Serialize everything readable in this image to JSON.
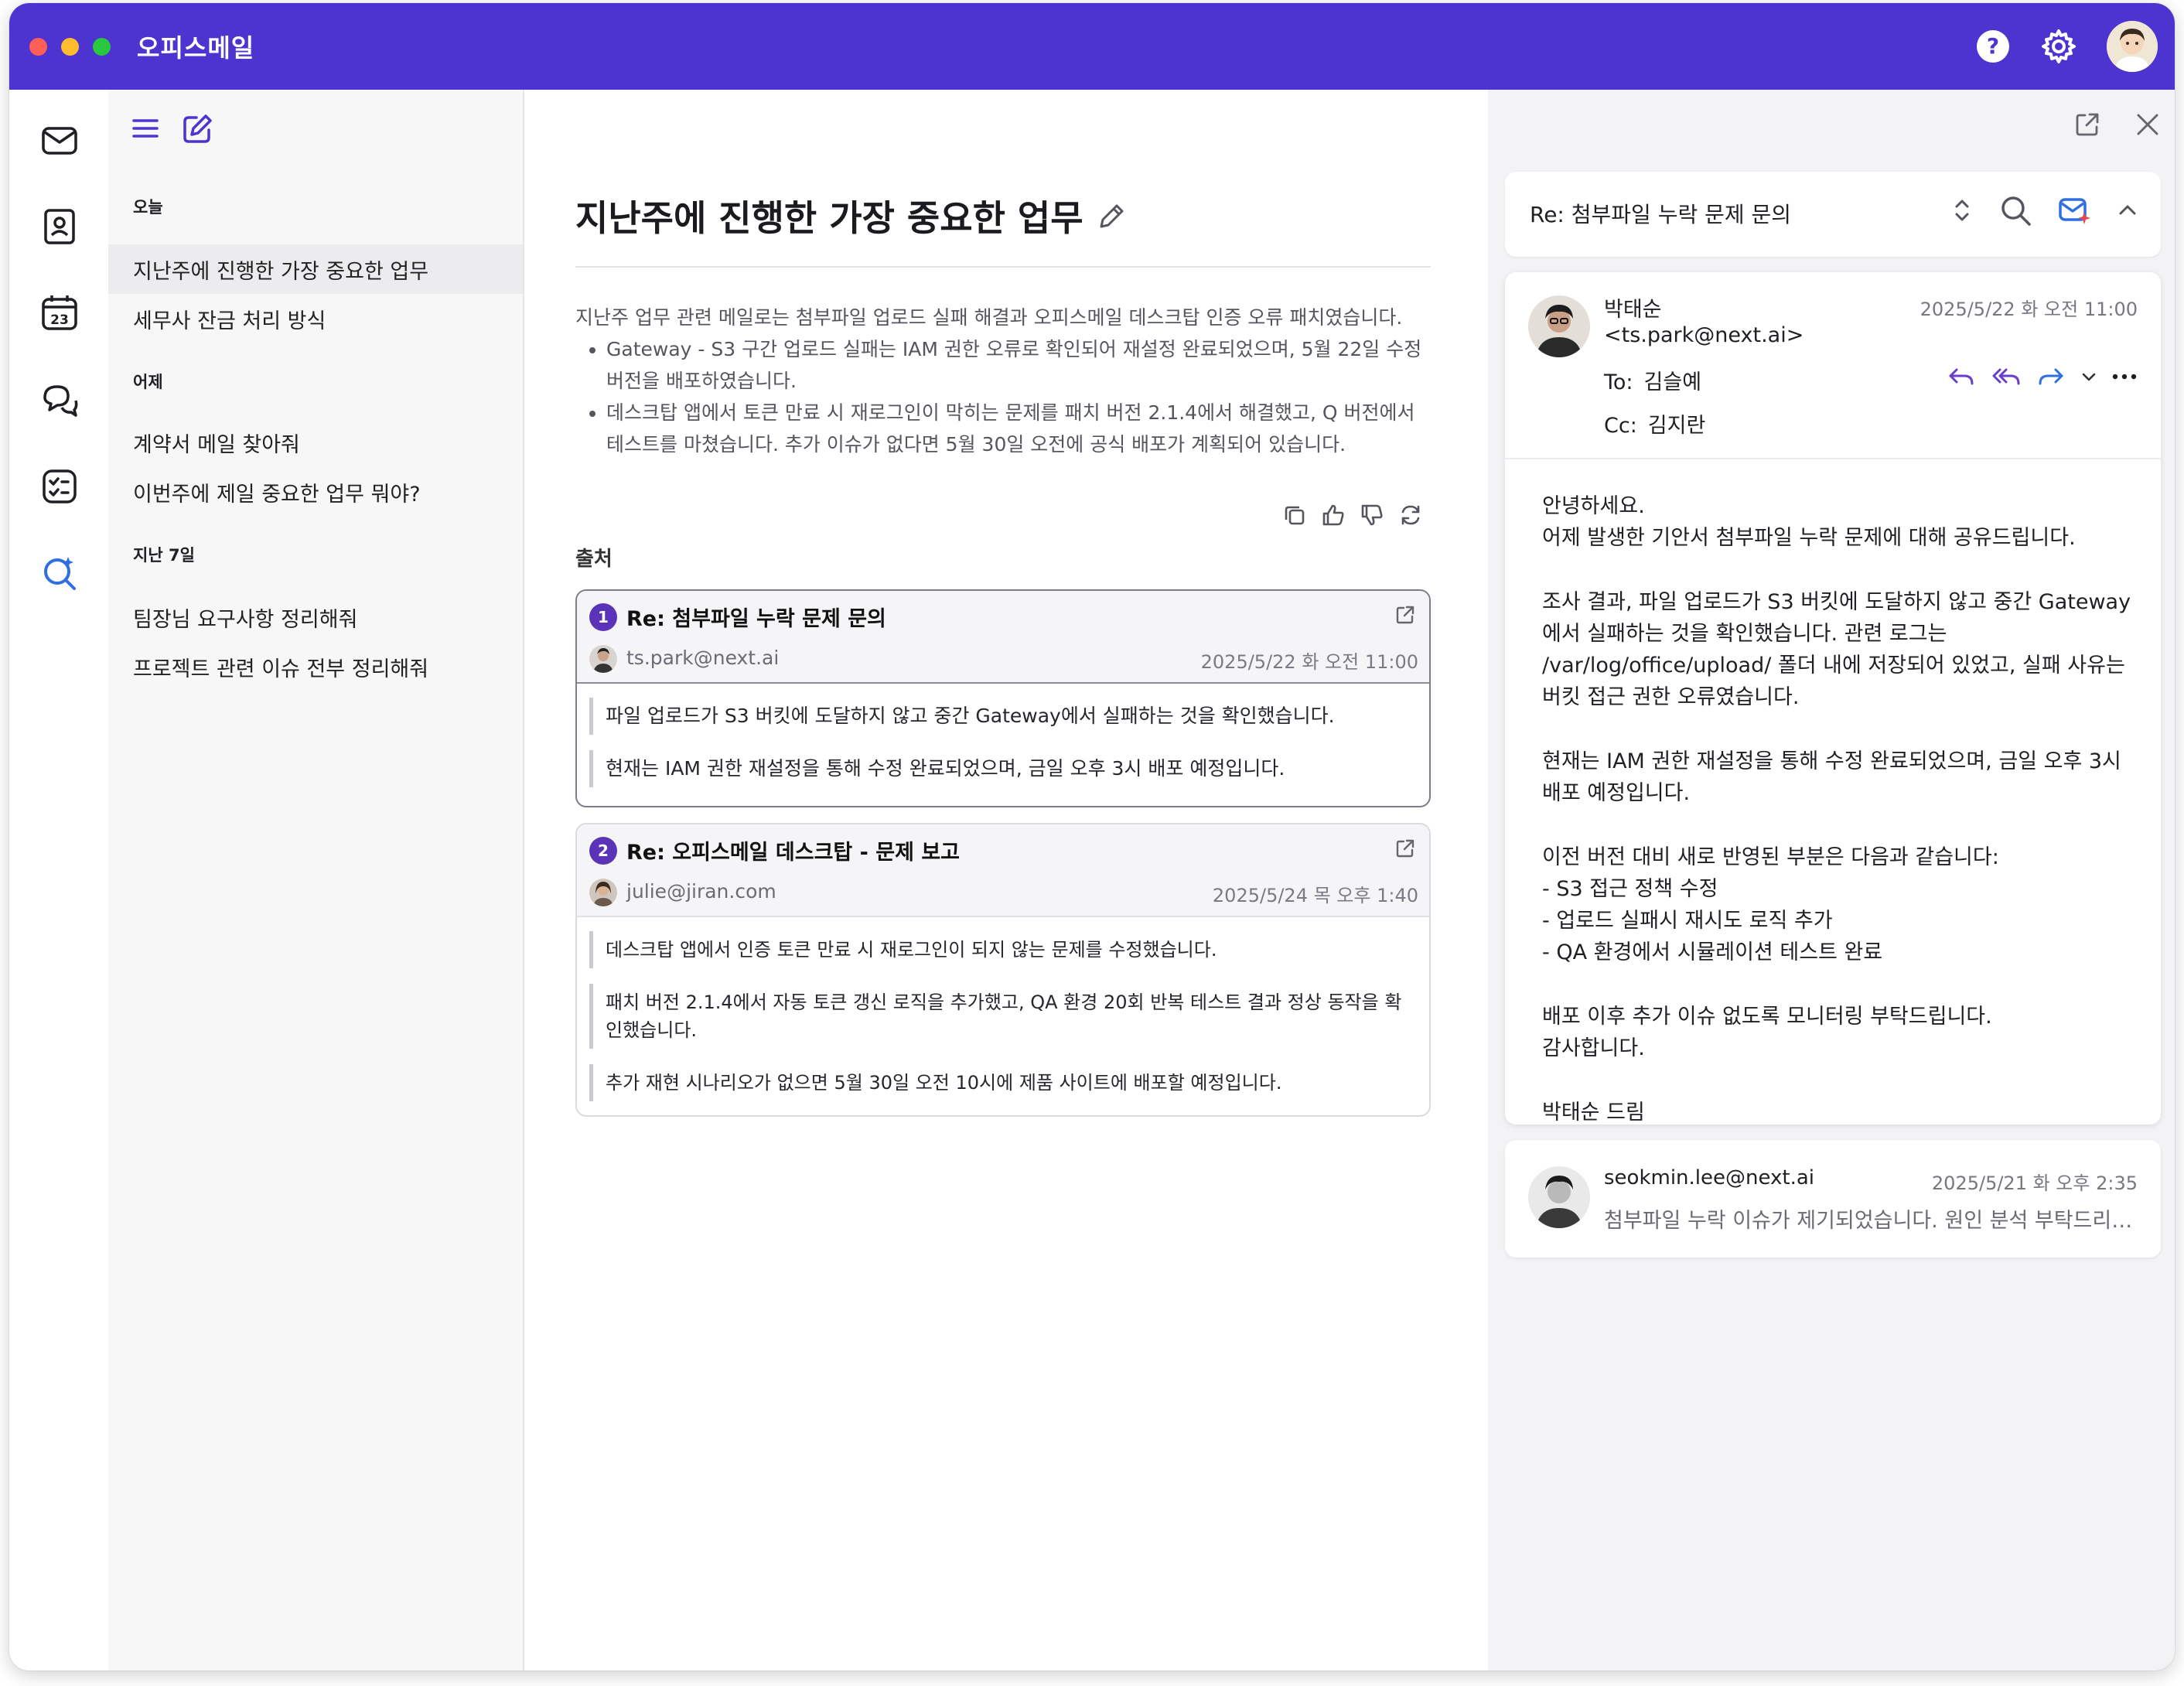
{
  "app": {
    "title": "오피스메일"
  },
  "list": {
    "groups": [
      {
        "label": "오늘",
        "items": [
          "지난주에 진행한 가장 중요한 업무",
          "세무사 잔금 처리 방식"
        ]
      },
      {
        "label": "어제",
        "items": [
          "계약서 메일 찾아줘",
          "이번주에 제일 중요한 업무 뭐야?"
        ]
      },
      {
        "label": "지난 7일",
        "items": [
          "팀장님 요구사항 정리해줘",
          "프로젝트 관련 이슈 전부 정리해줘"
        ]
      }
    ]
  },
  "main": {
    "title": "지난주에 진행한 가장 중요한 업무",
    "summary_intro": "지난주 업무 관련 메일로는 첨부파일 업로드 실패 해결과 오피스메일 데스크탑 인증 오류 패치였습니다.",
    "summary_bullets": [
      "Gateway - S3 구간 업로드 실패는 IAM 권한 오류로 확인되어 재설정 완료되었으며, 5월 22일 수정 버전을 배포하였습니다.",
      "데스크탑 앱에서 토큰 만료 시 재로그인이 막히는 문제를 패치 버전 2.1.4에서 해결했고, Q 버전에서 테스트를 마쳤습니다. 추가 이슈가 없다면 5월 30일 오전에 공식 배포가 계획되어 있습니다."
    ],
    "sources_label": "출처",
    "sources": [
      {
        "num": "1",
        "title": "Re: 첨부파일 누락 문제 문의",
        "from": "ts.park@next.ai",
        "date": "2025/5/22 화 오전 11:00",
        "quotes": [
          "파일 업로드가 S3 버킷에 도달하지 않고 중간 Gateway에서 실패하는 것을 확인했습니다.",
          "현재는 IAM 권한 재설정을 통해 수정 완료되었으며, 금일 오후 3시 배포 예정입니다."
        ]
      },
      {
        "num": "2",
        "title": "Re: 오피스메일 데스크탑 - 문제 보고",
        "from": "julie@jiran.com",
        "date": "2025/5/24 목 오후 1:40",
        "quotes": [
          "데스크탑 앱에서 인증 토큰 만료 시 재로그인이 되지 않는 문제를 수정했습니다.",
          "패치 버전 2.1.4에서 자동 토큰 갱신 로직을 추가했고, QA 환경 20회 반복 테스트 결과 정상 동작을 확인했습니다.",
          "추가 재현 시나리오가 없으면 5월 30일 오전 10시에 제품 사이트에 배포할 예정입니다."
        ]
      }
    ]
  },
  "reader": {
    "thread_title": "Re: 첨부파일 누락 문제 문의",
    "message": {
      "sender": "박태순",
      "sender_email": "<ts.park@next.ai>",
      "date": "2025/5/22 화 오전 11:00",
      "to_label": "To:",
      "to": "김슬예",
      "cc_label": "Cc:",
      "cc": "김지란",
      "body": [
        [
          "안녕하세요.",
          "어제 발생한 기안서 첨부파일 누락 문제에 대해 공유드립니다."
        ],
        [
          "조사 결과, 파일 업로드가 S3 버킷에 도달하지 않고 중간 Gateway에서 실패하는 것을 확인했습니다. 관련 로그는 /var/log/office/upload/ 폴더 내에 저장되어 있었고, 실패 사유는 버킷 접근 권한 오류였습니다."
        ],
        [
          "현재는 IAM 권한 재설정을 통해 수정 완료되었으며, 금일 오후 3시 배포 예정입니다."
        ],
        [
          "이전 버전 대비 새로 반영된 부분은 다음과 같습니다:",
          "- S3 접근 정책 수정",
          "- 업로드 실패시 재시도 로직 추가",
          "- QA 환경에서 시뮬레이션 테스트 완료"
        ],
        [
          "배포 이후 추가 이슈 없도록 모니터링 부탁드립니다.",
          "감사합니다."
        ],
        [
          "박태순 드림"
        ]
      ]
    },
    "message2": {
      "from": "seokmin.lee@next.ai",
      "date": "2025/5/21 화 오후 2:35",
      "preview": "첨부파일 누락 이슈가 제기되었습니다. 원인 분석 부탁드리겠습니다."
    }
  },
  "colors": {
    "brand": "#4d33cf",
    "accent": "#5a33b8",
    "rail_active": "#2f6fe0"
  },
  "icons": [
    "mail-icon",
    "contacts-icon",
    "calendar-icon",
    "chat-icon",
    "tasks-icon",
    "ai-search-icon",
    "help-icon",
    "gear-icon",
    "menu-icon",
    "compose-icon",
    "edit-icon",
    "copy-icon",
    "thumbs-up-icon",
    "thumbs-down-icon",
    "refresh-icon",
    "external-link-icon",
    "close-icon",
    "sort-icon",
    "search-icon",
    "ai-mail-icon",
    "chevron-up-icon",
    "reply-icon",
    "reply-all-icon",
    "forward-icon",
    "chevron-down-icon",
    "more-icon"
  ],
  "calendar_day": "23"
}
